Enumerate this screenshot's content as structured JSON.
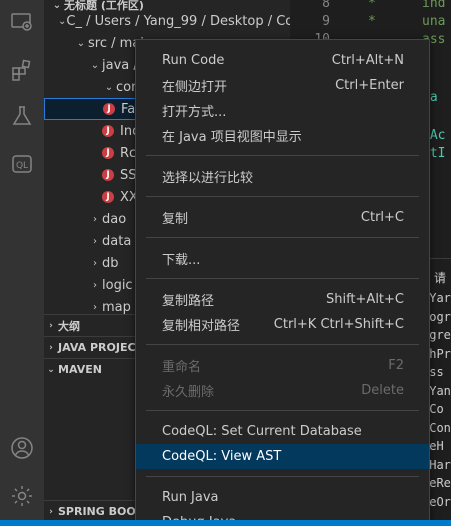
{
  "activity_bar": {
    "icons": [
      "remote-explorer-icon",
      "extensions-icon",
      "testing-flask-icon",
      "codeql-icon",
      "account-icon",
      "settings-gear-icon"
    ],
    "codeql_glyph": "QL"
  },
  "sidebar": {
    "workspace_title": "无标题 (工作区)",
    "path_row": "C_ / Users / Yang_99 / Desktop / Co...",
    "tree": [
      {
        "label": "src / mai",
        "chev": "⌄"
      },
      {
        "label": "java / c",
        "chev": "⌄"
      },
      {
        "label": "cont",
        "chev": "⌄"
      },
      {
        "label": "Fas",
        "java": true,
        "selected": true
      },
      {
        "label": "Ind",
        "java": true
      },
      {
        "label": "Rce",
        "java": true
      },
      {
        "label": "SSR",
        "java": true
      },
      {
        "label": "XXE",
        "java": true
      },
      {
        "label": "dao",
        "chev": "›"
      },
      {
        "label": "data",
        "chev": "›"
      },
      {
        "label": "db",
        "chev": "›"
      },
      {
        "label": "logic",
        "chev": "›"
      },
      {
        "label": "map",
        "chev": "›"
      }
    ],
    "sections": {
      "outline": "大纲",
      "java_projects": "JAVA PROJECT",
      "maven": "MAVEN",
      "spring_boot": "SPRING BOOT"
    }
  },
  "editor": {
    "line_numbers": [
      "8",
      "9",
      "10"
    ],
    "code_lines": [
      "ind",
      "una",
      "ass",
      "va",
      "yAc",
      "etI"
    ],
    "panel_lines": [
      "xYar",
      "rogr",
      "ogre",
      "thPr",
      "ess",
      "xYan",
      "eCo",
      "eCon",
      "keH",
      "eHar",
      "veRe",
      "veOr"
    ],
    "panel_head": "请"
  },
  "context_menu": {
    "groups": [
      [
        {
          "label": "Run Code",
          "shortcut": "Ctrl+Alt+N"
        },
        {
          "label": "在侧边打开",
          "shortcut": "Ctrl+Enter"
        },
        {
          "label": "打开方式...",
          "shortcut": ""
        },
        {
          "label": "在 Java 项目视图中显示",
          "shortcut": ""
        }
      ],
      [
        {
          "label": "选择以进行比较",
          "shortcut": ""
        }
      ],
      [
        {
          "label": "复制",
          "shortcut": "Ctrl+C"
        }
      ],
      [
        {
          "label": "下载...",
          "shortcut": ""
        }
      ],
      [
        {
          "label": "复制路径",
          "shortcut": "Shift+Alt+C"
        },
        {
          "label": "复制相对路径",
          "shortcut": "Ctrl+K Ctrl+Shift+C"
        }
      ],
      [
        {
          "label": "重命名",
          "shortcut": "F2",
          "disabled": true
        },
        {
          "label": "永久删除",
          "shortcut": "Delete",
          "disabled": true
        }
      ],
      [
        {
          "label": "CodeQL: Set Current Database",
          "shortcut": ""
        },
        {
          "label": "CodeQL: View AST",
          "shortcut": "",
          "hover": true
        }
      ],
      [
        {
          "label": "Run Java",
          "shortcut": ""
        },
        {
          "label": "Debug Java",
          "shortcut": ""
        }
      ]
    ]
  },
  "colors": {
    "accent": "#007acc",
    "menu_hover": "#04395e",
    "java_icon": "#cc3e44",
    "comment_green": "#6a9955"
  }
}
